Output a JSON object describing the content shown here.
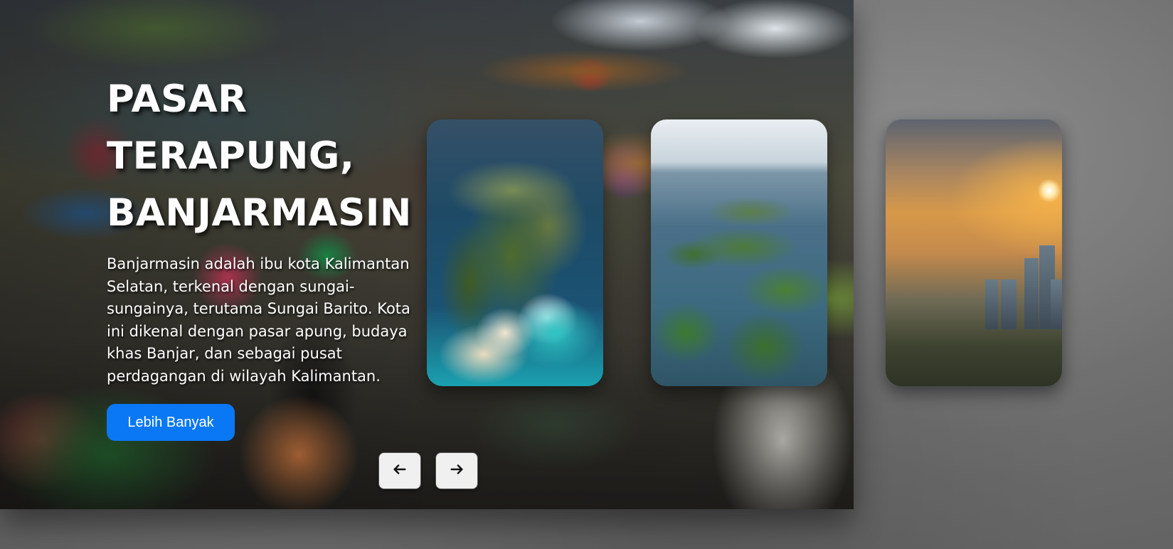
{
  "hero": {
    "title_line1": "PASAR",
    "title_line2": "TERAPUNG,",
    "title_line3": "BANJARMASIN",
    "description": "Banjarmasin adalah ibu kota Kalimantan Selatan, terkenal dengan sungai-sungainya, terutama Sungai Barito. Kota ini dikenal dengan pasar apung, budaya khas Banjar, dan sebagai pusat perdagangan di wilayah Kalimantan.",
    "button_label": "Lebih Banyak",
    "button_color": "#0a78f5"
  },
  "cards": [
    {
      "image": "rock-cliff-beach-photo"
    },
    {
      "image": "tropical-islands-photo"
    },
    {
      "image": "city-sunset-photo"
    }
  ],
  "navigation": {
    "prev_icon": "arrow-left-icon",
    "next_icon": "arrow-right-icon"
  }
}
